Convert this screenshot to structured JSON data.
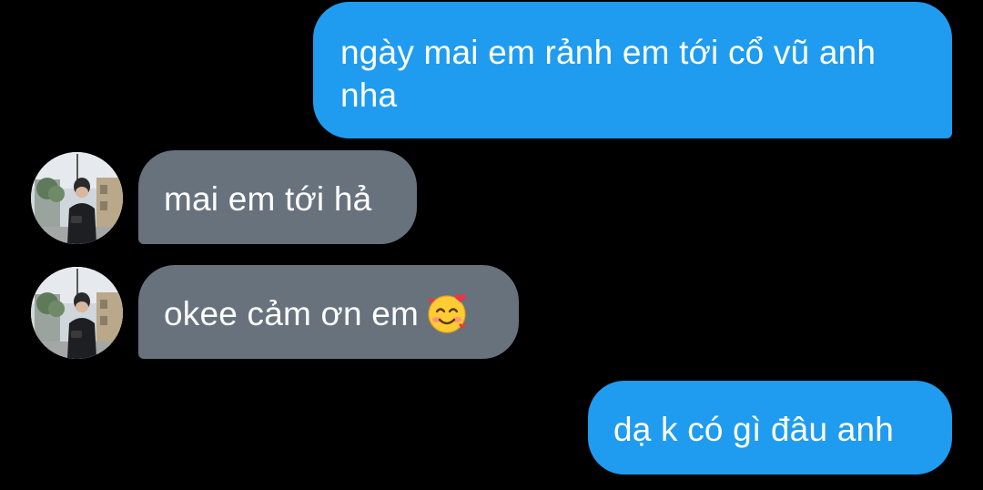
{
  "messages": [
    {
      "sender": "me",
      "text": "ngày mai em rảnh em tới cổ vũ anh nha"
    },
    {
      "sender": "contact",
      "text": "mai em tới hả"
    },
    {
      "sender": "contact",
      "text": "okee cảm ơn em",
      "emoji": "smiling-face-with-hearts-icon"
    },
    {
      "sender": "me",
      "text": "dạ k có gì đâu anh"
    }
  ],
  "colors": {
    "background": "#000000",
    "outgoing_bubble": "#1f9cf0",
    "incoming_bubble": "#67727d",
    "text": "#ffffff"
  }
}
